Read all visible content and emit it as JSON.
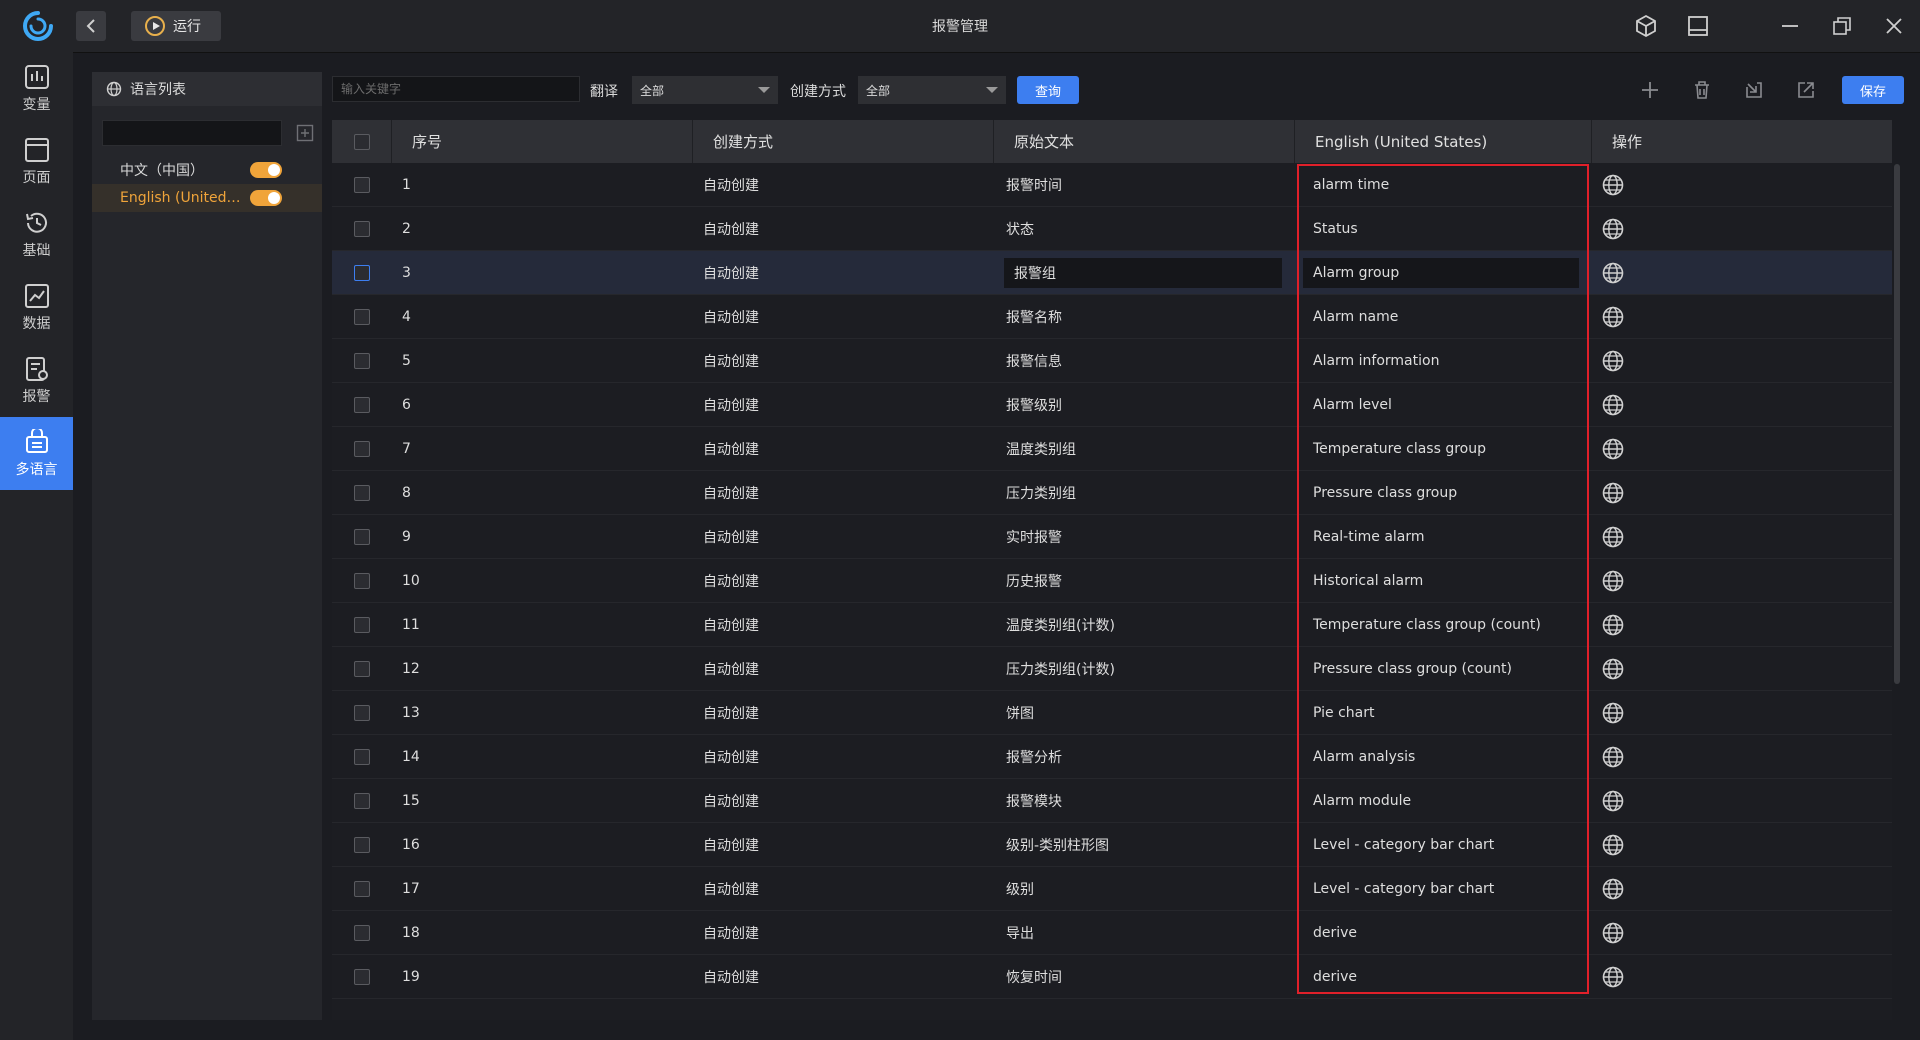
{
  "window": {
    "title": "报警管理",
    "run_label": "运行"
  },
  "nav": {
    "items": [
      {
        "label": "变量",
        "icon": "variable-icon"
      },
      {
        "label": "页面",
        "icon": "page-icon"
      },
      {
        "label": "基础",
        "icon": "history-icon"
      },
      {
        "label": "数据",
        "icon": "chart-icon"
      },
      {
        "label": "报警",
        "icon": "alarm-icon"
      },
      {
        "label": "多语言",
        "icon": "multilanguage-icon"
      }
    ],
    "active_index": 5
  },
  "language_panel": {
    "header": "语言列表",
    "items": [
      {
        "label": "中文（中国）",
        "enabled": true,
        "selected": false
      },
      {
        "label": "English (United ...",
        "enabled": true,
        "selected": true
      }
    ]
  },
  "toolbar": {
    "keyword_placeholder": "输入关键字",
    "translate_label": "翻译",
    "translate_value": "全部",
    "create_label": "创建方式",
    "create_value": "全部",
    "query_button": "查询",
    "save_button": "保存"
  },
  "table": {
    "columns": [
      "序号",
      "创建方式",
      "原始文本",
      "English (United States)",
      "操作"
    ],
    "selected_row": 3,
    "editing_row": 3,
    "rows": [
      {
        "no": "1",
        "create": "自动创建",
        "original": "报警时间",
        "english": "alarm time"
      },
      {
        "no": "2",
        "create": "自动创建",
        "original": "状态",
        "english": "Status"
      },
      {
        "no": "3",
        "create": "自动创建",
        "original": "报警组",
        "english": "Alarm group"
      },
      {
        "no": "4",
        "create": "自动创建",
        "original": "报警名称",
        "english": "Alarm name"
      },
      {
        "no": "5",
        "create": "自动创建",
        "original": "报警信息",
        "english": "Alarm information"
      },
      {
        "no": "6",
        "create": "自动创建",
        "original": "报警级别",
        "english": "Alarm level"
      },
      {
        "no": "7",
        "create": "自动创建",
        "original": "温度类别组",
        "english": "Temperature class group"
      },
      {
        "no": "8",
        "create": "自动创建",
        "original": "压力类别组",
        "english": "Pressure class group"
      },
      {
        "no": "9",
        "create": "自动创建",
        "original": "实时报警",
        "english": "Real-time alarm"
      },
      {
        "no": "10",
        "create": "自动创建",
        "original": "历史报警",
        "english": "Historical alarm"
      },
      {
        "no": "11",
        "create": "自动创建",
        "original": "温度类别组(计数)",
        "english": "Temperature class group (count)"
      },
      {
        "no": "12",
        "create": "自动创建",
        "original": "压力类别组(计数)",
        "english": "Pressure class group (count)"
      },
      {
        "no": "13",
        "create": "自动创建",
        "original": "饼图",
        "english": "Pie chart"
      },
      {
        "no": "14",
        "create": "自动创建",
        "original": "报警分析",
        "english": "Alarm analysis"
      },
      {
        "no": "15",
        "create": "自动创建",
        "original": "报警模块",
        "english": "Alarm module"
      },
      {
        "no": "16",
        "create": "自动创建",
        "original": "级别-类别柱形图",
        "english": "Level - category bar chart"
      },
      {
        "no": "17",
        "create": "自动创建",
        "original": "级别",
        "english": "Level - category bar chart"
      },
      {
        "no": "18",
        "create": "自动创建",
        "original": "导出",
        "english": "derive"
      },
      {
        "no": "19",
        "create": "自动创建",
        "original": "恢复时间",
        "english": "derive"
      }
    ]
  },
  "colors": {
    "accent": "#3d7ef0",
    "toggle": "#f0a43a",
    "highlight_border": "#e0202a"
  }
}
